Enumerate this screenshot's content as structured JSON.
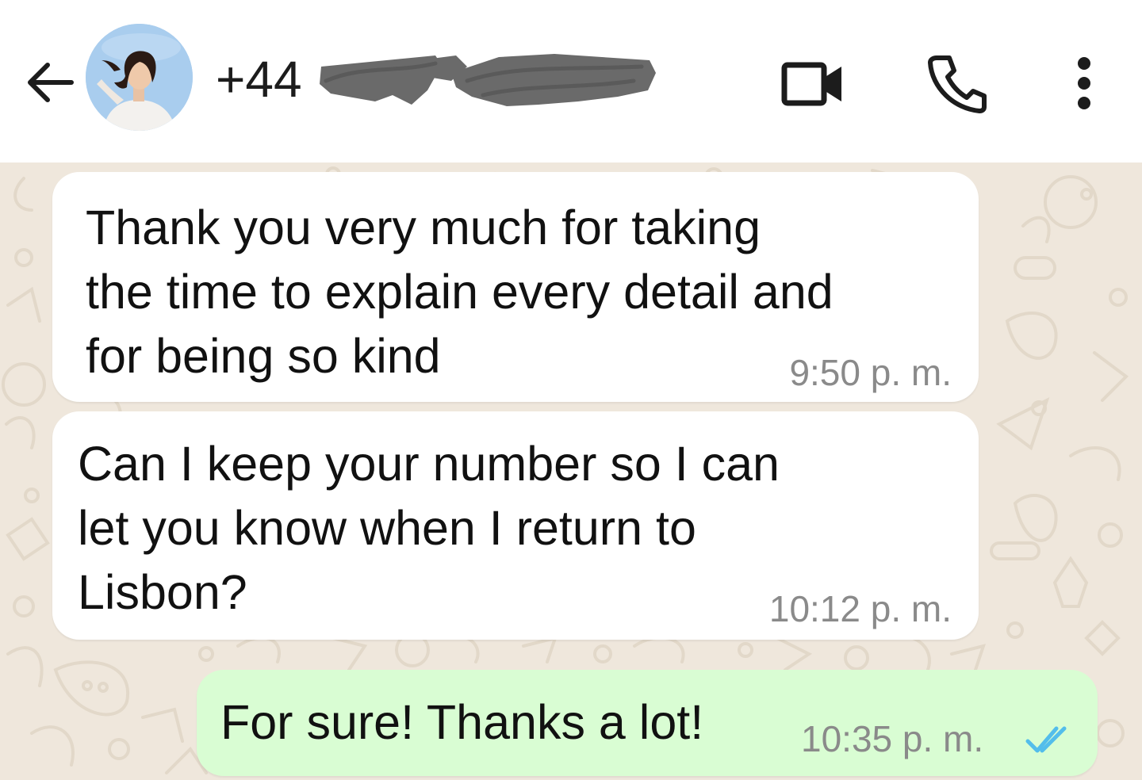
{
  "header": {
    "contact_prefix": "+44",
    "contact_number_redacted": true,
    "icons": {
      "back": "arrow-left-icon",
      "video": "video-camera-icon",
      "call": "phone-icon",
      "menu": "more-vertical-icon"
    }
  },
  "messages": [
    {
      "direction": "incoming",
      "text": "Thank you very much for taking\nthe time to explain every detail and\nfor being so kind",
      "time": "9:50 p. m."
    },
    {
      "direction": "incoming",
      "text": "Can I keep your number so I can\nlet you know when I return to\nLisbon?",
      "time": "10:12 p. m."
    },
    {
      "direction": "outgoing",
      "text": "For sure! Thanks a lot!",
      "time": "10:35 p. m.",
      "status": "read"
    }
  ],
  "colors": {
    "chat_background": "#efe7dc",
    "incoming_bubble": "#ffffff",
    "outgoing_bubble": "#d9fdd3",
    "read_ticks": "#53bdeb",
    "timestamp": "#8a8a8a"
  }
}
